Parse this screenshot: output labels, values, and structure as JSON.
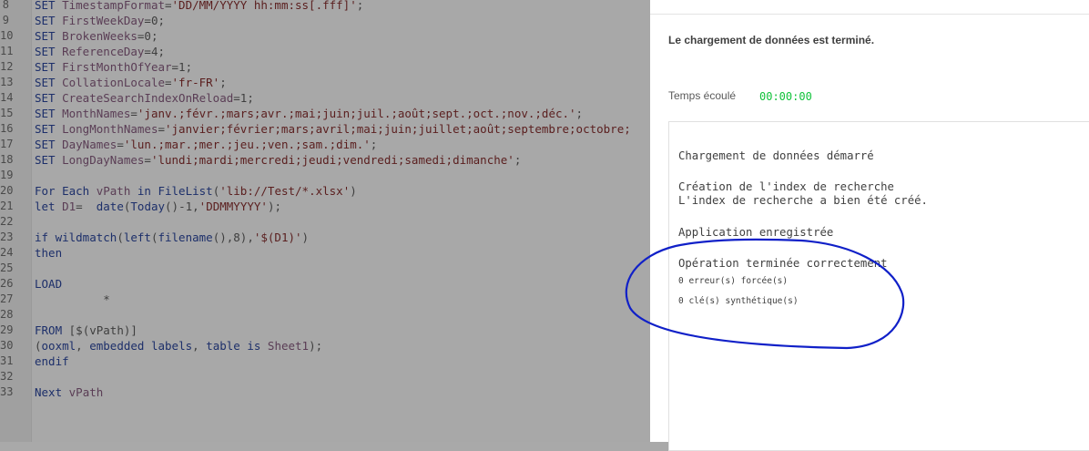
{
  "editor": {
    "lines": [
      {
        "n": "8",
        "segs": [
          [
            "kw",
            "SET "
          ],
          [
            "vr",
            "TimestampFormat"
          ],
          [
            "pl",
            "="
          ],
          [
            "st",
            "'DD/MM/YYYY hh:mm:ss[.fff]'"
          ],
          [
            "pl",
            ";"
          ]
        ]
      },
      {
        "n": "9",
        "segs": [
          [
            "kw",
            "SET "
          ],
          [
            "vr",
            "FirstWeekDay"
          ],
          [
            "pl",
            "=0;"
          ]
        ]
      },
      {
        "n": "10",
        "segs": [
          [
            "kw",
            "SET "
          ],
          [
            "vr",
            "BrokenWeeks"
          ],
          [
            "pl",
            "=0;"
          ]
        ]
      },
      {
        "n": "11",
        "segs": [
          [
            "kw",
            "SET "
          ],
          [
            "vr",
            "ReferenceDay"
          ],
          [
            "pl",
            "=4;"
          ]
        ]
      },
      {
        "n": "12",
        "segs": [
          [
            "kw",
            "SET "
          ],
          [
            "vr",
            "FirstMonthOfYear"
          ],
          [
            "pl",
            "=1;"
          ]
        ]
      },
      {
        "n": "13",
        "segs": [
          [
            "kw",
            "SET "
          ],
          [
            "vr",
            "CollationLocale"
          ],
          [
            "pl",
            "="
          ],
          [
            "st",
            "'fr-FR'"
          ],
          [
            "pl",
            ";"
          ]
        ]
      },
      {
        "n": "14",
        "segs": [
          [
            "kw",
            "SET "
          ],
          [
            "vr",
            "CreateSearchIndexOnReload"
          ],
          [
            "pl",
            "=1;"
          ]
        ]
      },
      {
        "n": "15",
        "segs": [
          [
            "kw",
            "SET "
          ],
          [
            "vr",
            "MonthNames"
          ],
          [
            "pl",
            "="
          ],
          [
            "st",
            "'janv.;févr.;mars;avr.;mai;juin;juil.;août;sept.;oct.;nov.;déc.'"
          ],
          [
            "pl",
            ";"
          ]
        ]
      },
      {
        "n": "16",
        "segs": [
          [
            "kw",
            "SET "
          ],
          [
            "vr",
            "LongMonthNames"
          ],
          [
            "pl",
            "="
          ],
          [
            "st",
            "'janvier;février;mars;avril;mai;juin;juillet;août;septembre;octobre;"
          ]
        ]
      },
      {
        "n": "17",
        "segs": [
          [
            "kw",
            "SET "
          ],
          [
            "vr",
            "DayNames"
          ],
          [
            "pl",
            "="
          ],
          [
            "st",
            "'lun.;mar.;mer.;jeu.;ven.;sam.;dim.'"
          ],
          [
            "pl",
            ";"
          ]
        ]
      },
      {
        "n": "18",
        "segs": [
          [
            "kw",
            "SET "
          ],
          [
            "vr",
            "LongDayNames"
          ],
          [
            "pl",
            "="
          ],
          [
            "st",
            "'lundi;mardi;mercredi;jeudi;vendredi;samedi;dimanche'"
          ],
          [
            "pl",
            ";"
          ]
        ]
      },
      {
        "n": "19",
        "segs": []
      },
      {
        "n": "20",
        "segs": [
          [
            "kw",
            "For Each "
          ],
          [
            "vr",
            "vPath"
          ],
          [
            "kw",
            " in "
          ],
          [
            "fn",
            "FileList"
          ],
          [
            "pl",
            "("
          ],
          [
            "st",
            "'lib://Test/*.xlsx'"
          ],
          [
            "pl",
            ")"
          ]
        ]
      },
      {
        "n": "21",
        "segs": [
          [
            "kw",
            "let "
          ],
          [
            "vr",
            "D1"
          ],
          [
            "pl",
            "=  "
          ],
          [
            "fn",
            "date"
          ],
          [
            "pl",
            "("
          ],
          [
            "fn",
            "Today"
          ],
          [
            "pl",
            "()-1,"
          ],
          [
            "st",
            "'DDMMYYYY'"
          ],
          [
            "pl",
            ");"
          ]
        ]
      },
      {
        "n": "22",
        "segs": []
      },
      {
        "n": "23",
        "segs": [
          [
            "kw",
            "if "
          ],
          [
            "fn",
            "wildmatch"
          ],
          [
            "pl",
            "("
          ],
          [
            "fn",
            "left"
          ],
          [
            "pl",
            "("
          ],
          [
            "fn",
            "filename"
          ],
          [
            "pl",
            "(),8),"
          ],
          [
            "st",
            "'$(D1)'"
          ],
          [
            "pl",
            ")"
          ]
        ]
      },
      {
        "n": "24",
        "segs": [
          [
            "kw",
            "then"
          ]
        ]
      },
      {
        "n": "25",
        "segs": []
      },
      {
        "n": "26",
        "segs": [
          [
            "kw",
            "LOAD"
          ]
        ]
      },
      {
        "n": "27",
        "segs": [
          [
            "pl",
            "          *"
          ]
        ]
      },
      {
        "n": "28",
        "segs": []
      },
      {
        "n": "29",
        "segs": [
          [
            "kw",
            "FROM "
          ],
          [
            "pl",
            "[$(vPath)]"
          ]
        ]
      },
      {
        "n": "30",
        "segs": [
          [
            "pl",
            "("
          ],
          [
            "kw",
            "ooxml"
          ],
          [
            "pl",
            ", "
          ],
          [
            "kw",
            "embedded labels"
          ],
          [
            "pl",
            ", "
          ],
          [
            "kw",
            "table is "
          ],
          [
            "vr",
            "Sheet1"
          ],
          [
            "pl",
            ");"
          ]
        ]
      },
      {
        "n": "31",
        "segs": [
          [
            "kw",
            "endif"
          ]
        ]
      },
      {
        "n": "32",
        "segs": []
      },
      {
        "n": "33",
        "segs": [
          [
            "kw",
            "Next "
          ],
          [
            "vr",
            "vPath"
          ]
        ]
      }
    ]
  },
  "dialog": {
    "done_message": "Le chargement de données est terminé.",
    "elapsed_label": "Temps écoulé",
    "elapsed_value": "00:00:00",
    "log": {
      "started": "Chargement de données démarré",
      "index_creating": "Création de l'index de recherche",
      "index_created": "L'index de recherche a bien été créé.",
      "app_saved": "Application enregistrée",
      "success": "Opération terminée correctement",
      "errors": "0 erreur(s) forcée(s)",
      "synthetic_keys": "0 clé(s) synthétique(s)"
    }
  },
  "annotation": {
    "color": "#1020c8"
  }
}
